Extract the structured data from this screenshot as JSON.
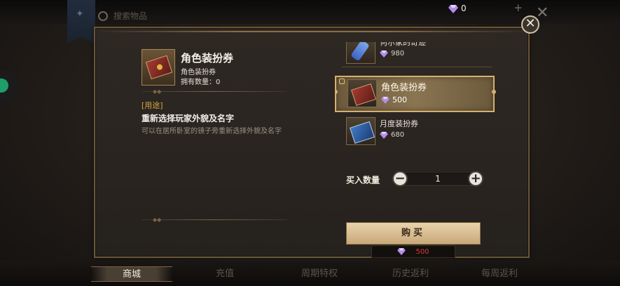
{
  "topbar": {
    "search_hint": "搜索物品",
    "currency_value": "0",
    "currency_plus": "+"
  },
  "detail": {
    "item_name": "角色装扮券",
    "item_subtype": "角色装扮券",
    "owned_label": "拥有数量：0",
    "usage_title": "[用途]",
    "usage_heading": "重新选择玩家外貌及名字",
    "usage_body": "可以在居所卧室的镜子旁重新选择外貌及名字"
  },
  "shop_list": [
    {
      "name": "何尔家的奇迹",
      "price": "980",
      "icon": "bottle-icon",
      "selected": false
    },
    {
      "name": "角色装扮券",
      "price": "500",
      "icon": "red-ticket-icon",
      "selected": true
    },
    {
      "name": "月度装扮券",
      "price": "680",
      "icon": "blue-ticket-icon",
      "selected": false
    }
  ],
  "purchase": {
    "qty_label": "买入数量",
    "qty_value": "1",
    "minus": "−",
    "plus": "+",
    "buy_label": "购买",
    "total_cost": "500"
  },
  "tabs": [
    {
      "label": "商城",
      "active": true
    },
    {
      "label": "充值",
      "active": false
    },
    {
      "label": "周期特权",
      "active": false
    },
    {
      "label": "历史返利",
      "active": false
    },
    {
      "label": "每周返利",
      "active": false
    }
  ],
  "colors": {
    "gold_accent": "#d6b16e",
    "usage_title": "#d4a640",
    "cost_red": "#d63a35",
    "gem": "#b58ce8"
  }
}
